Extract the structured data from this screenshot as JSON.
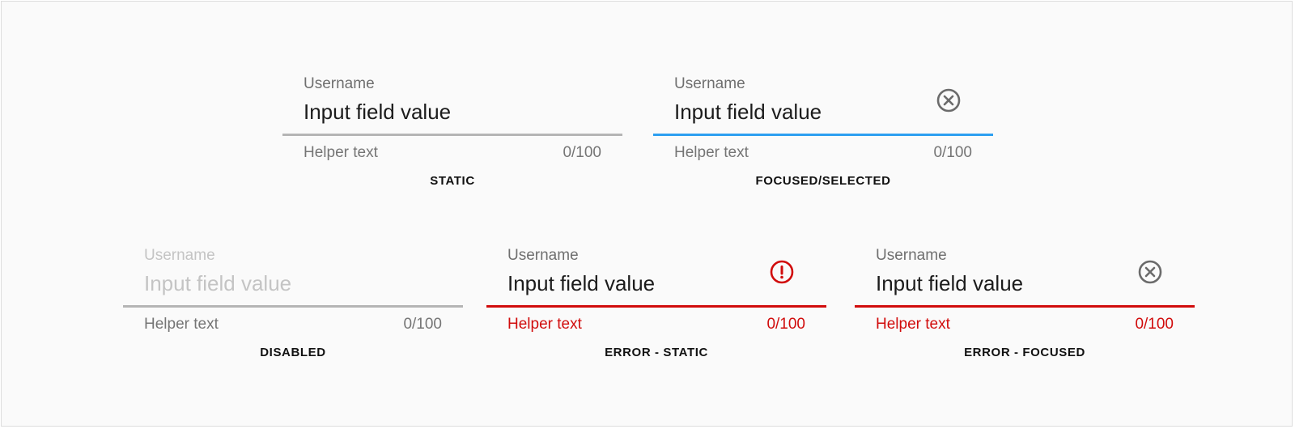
{
  "colors": {
    "background": "#fafafa",
    "underline_default": "#b5b5b5",
    "underline_focused": "#2d9ff0",
    "error": "#d10c0c",
    "disabled_text": "#c4c4c4"
  },
  "fields": {
    "static": {
      "label": "Username",
      "value": "Input field value",
      "helper": "Helper text",
      "counter": "0/100",
      "caption": "STATIC"
    },
    "focused": {
      "label": "Username",
      "value": "Input field value",
      "helper": "Helper text",
      "counter": "0/100",
      "caption": "FOCUSED/SELECTED",
      "trailing_icon": "clear-icon"
    },
    "disabled": {
      "label": "Username",
      "value": "Input field value",
      "helper": "Helper text",
      "counter": "0/100",
      "caption": "DISABLED"
    },
    "error_static": {
      "label": "Username",
      "value": "Input field value",
      "helper": "Helper text",
      "counter": "0/100",
      "caption": "ERROR - STATIC",
      "trailing_icon": "error-icon"
    },
    "error_focused": {
      "label": "Username",
      "value": "Input field value",
      "helper": "Helper text",
      "counter": "0/100",
      "caption": "ERROR - FOCUSED",
      "trailing_icon": "clear-icon"
    }
  }
}
